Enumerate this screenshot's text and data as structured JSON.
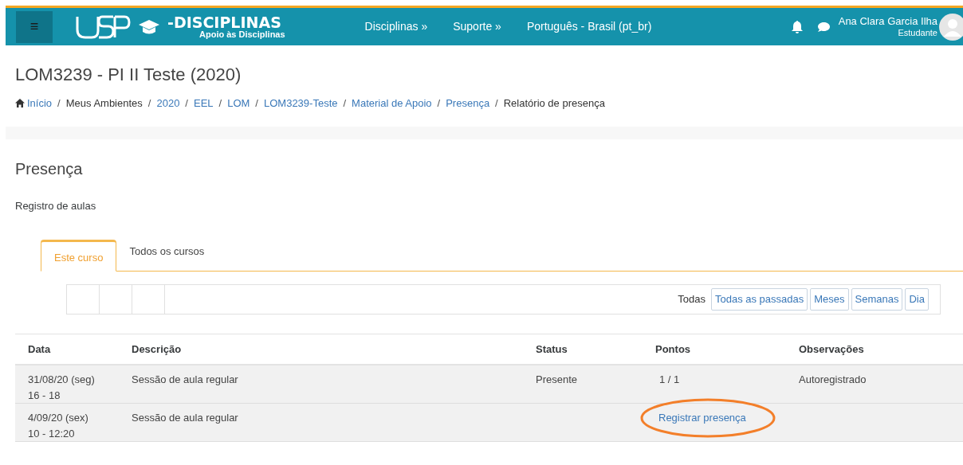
{
  "navbar": {
    "menu_icon": "≡",
    "logo": {
      "title": "-DISCIPLINAS",
      "subtitle": "Apoio às Disciplinas"
    },
    "links": [
      "Disciplinas »",
      "Suporte »",
      "Português - Brasil (pt_br)"
    ],
    "user": {
      "name": "Ana Clara Garcia Ilha",
      "role": "Estudante"
    }
  },
  "course_title": "LOM3239 - PI II Teste (2020)",
  "breadcrumb_separator": "/",
  "breadcrumb": [
    {
      "label": "Início",
      "link": true
    },
    {
      "label": "Meus Ambientes",
      "link": false
    },
    {
      "label": "2020",
      "link": true
    },
    {
      "label": "EEL",
      "link": true
    },
    {
      "label": "LOM",
      "link": true
    },
    {
      "label": "LOM3239-Teste",
      "link": true
    },
    {
      "label": "Material de Apoio",
      "link": true
    },
    {
      "label": "Presença",
      "link": true
    },
    {
      "label": "Relatório de presença",
      "link": false
    }
  ],
  "page_title": "Presença",
  "subtitle": "Registro de aulas",
  "tabs": [
    {
      "label": "Este curso",
      "selected": true
    },
    {
      "label": "Todos os cursos",
      "selected": false
    }
  ],
  "filters": [
    {
      "label": "Todas",
      "selected": true
    },
    {
      "label": "Todas as passadas",
      "selected": false
    },
    {
      "label": "Meses",
      "selected": false
    },
    {
      "label": "Semanas",
      "selected": false
    },
    {
      "label": "Dia",
      "selected": false
    }
  ],
  "table": {
    "columns": [
      "Data",
      "Descrição",
      "Status",
      "Pontos",
      "Observações"
    ],
    "rows": [
      {
        "date": "31/08/20 (seg)",
        "time": "16 - 18",
        "description": "Sessão de aula regular",
        "status": "Presente",
        "points": "1 / 1",
        "points_link": false,
        "notes": "Autoregistrado",
        "highlighted": false
      },
      {
        "date": "4/09/20 (sex)",
        "time": "10 - 12:20",
        "description": "Sessão de aula regular",
        "points": "Registrar presença",
        "points_link": true,
        "highlighted": true
      }
    ]
  }
}
